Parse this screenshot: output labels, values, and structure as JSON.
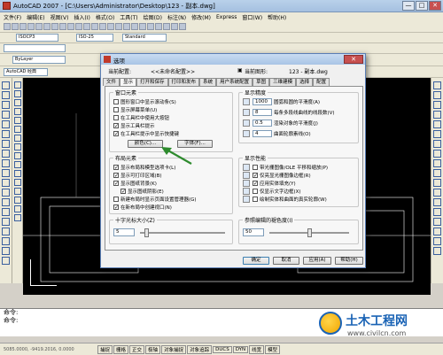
{
  "window": {
    "title": "AutoCAD 2007 - [C:\\Users\\Administrator\\Desktop\\123 - 副本.dwg]",
    "min": "—",
    "max": "□",
    "close": "✕"
  },
  "menu": [
    "文件(F)",
    "编辑(E)",
    "视图(V)",
    "插入(I)",
    "格式(O)",
    "工具(T)",
    "绘图(D)",
    "标注(N)",
    "修改(M)",
    "Express",
    "窗口(W)",
    "帮助(H)"
  ],
  "toolbar": {
    "textstyle": "ISOCP3",
    "dimstyle": "ISO-25",
    "tablestyle": "Standard",
    "layer": "ByLayer"
  },
  "model_label": "AutoCAD 经典",
  "command": {
    "line1": "命令:",
    "line2": "命令:"
  },
  "status": {
    "coords": "5085.0000, -9419.2016, 0.0000",
    "buttons": [
      "捕捉",
      "栅格",
      "正交",
      "极轴",
      "对象捕捉",
      "对象追踪",
      "DUCS",
      "DYN",
      "线宽",
      "模型"
    ]
  },
  "dialog": {
    "title": "选项",
    "current_profile_label": "当前配置:",
    "current_profile_value": "<<未命名配置>>",
    "current_drawing_label": "当前图形:",
    "current_drawing_value": "123 - 副本.dwg",
    "tabs": [
      "文件",
      "显示",
      "打开和保存",
      "打印和发布",
      "系统",
      "用户系统配置",
      "草图",
      "三维建模",
      "选择",
      "配置"
    ],
    "active_tab": 1,
    "window_elements": {
      "title": "窗口元素",
      "checks": [
        {
          "label": "图形窗口中显示滚动条(S)",
          "checked": false
        },
        {
          "label": "显示屏幕菜单(U)",
          "checked": false
        },
        {
          "label": "在工具栏中使用大按钮",
          "checked": false
        },
        {
          "label": "显示工具栏提示",
          "checked": true
        },
        {
          "label": "在工具栏提示中显示快捷键",
          "checked": true
        }
      ],
      "colors_button": "颜色(C)...",
      "fonts_button": "字体(F)..."
    },
    "display_resolution": {
      "title": "显示精度",
      "items": [
        {
          "value": "1000",
          "label": "圆弧和圆的平滑度(A)"
        },
        {
          "value": "8",
          "label": "每条多段线曲线的线段数(V)"
        },
        {
          "value": "0.5",
          "label": "渲染对象的平滑度(J)"
        },
        {
          "value": "4",
          "label": "曲面轮廓素线(O)"
        }
      ]
    },
    "layout_elements": {
      "title": "布局元素",
      "checks": [
        {
          "label": "显示布局和模型选项卡(L)",
          "checked": true
        },
        {
          "label": "显示可打印区域(B)",
          "checked": true
        },
        {
          "label": "显示图纸背景(K)",
          "checked": true
        },
        {
          "label": "显示图纸阴影(E)",
          "checked": true
        },
        {
          "label": "新建布局时显示页面设置管理器(G)",
          "checked": false
        },
        {
          "label": "在新布局中创建视口(N)",
          "checked": true
        }
      ]
    },
    "display_performance": {
      "title": "显示性能",
      "checks": [
        {
          "label": "带光栅图像/OLE 平移和缩放(P)",
          "checked": false
        },
        {
          "label": "仅亮显光栅图像边框(R)",
          "checked": true
        },
        {
          "label": "应用实体填充(Y)",
          "checked": true
        },
        {
          "label": "仅显示文字边框(X)",
          "checked": false
        },
        {
          "label": "绘制实体和曲面的真实轮廓(W)",
          "checked": false
        }
      ]
    },
    "crosshair": {
      "title": "十字光标大小(Z)",
      "value": "5",
      "fraction": 0.05
    },
    "fade": {
      "title": "参照编辑的褪色度(I)",
      "value": "50",
      "fraction": 0.5
    },
    "buttons": {
      "ok": "确定",
      "cancel": "取消",
      "apply": "应用(A)",
      "help": "帮助(H)"
    }
  },
  "watermark": {
    "title": "土木工程网",
    "url": "www.civilcn.com"
  },
  "colors": {
    "accent": "#1a63b5",
    "close": "#c75050",
    "arrow": "#2e8b2e"
  }
}
